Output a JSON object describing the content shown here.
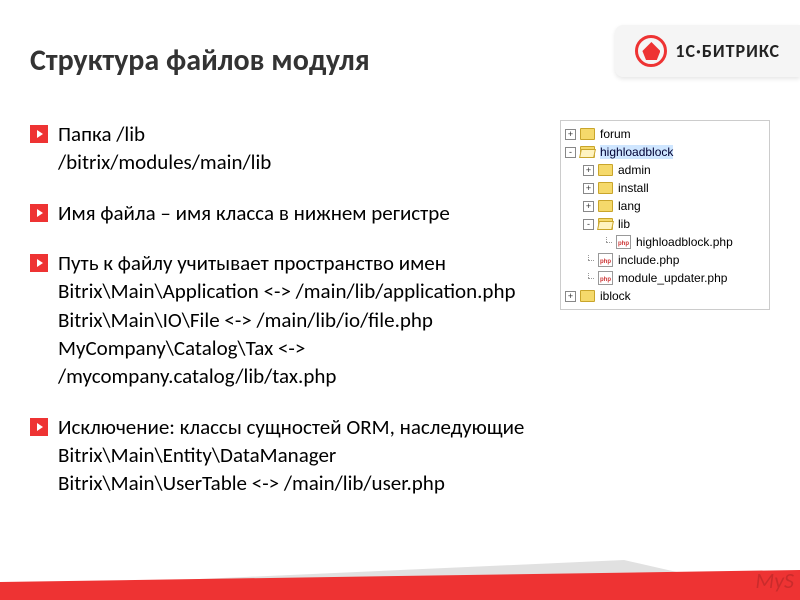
{
  "header": {
    "title": "Структура файлов модуля",
    "brand": "1С·БИТРИКС"
  },
  "bullets": [
    {
      "text": "Папка   /lib\n/bitrix/modules/main/lib"
    },
    {
      "text": "Имя файла – имя класса в нижнем регистре"
    },
    {
      "text": "Путь к файлу учитывает пространство имен\nBitrix\\Main\\Application  <->  /main/lib/application.php\nBitrix\\Main\\IO\\File  <->  /main/lib/io/file.php\nMyCompany\\Catalog\\Tax  <->  /mycompany.catalog/lib/tax.php"
    },
    {
      "text": "Исключение: классы сущностей ORM, наследующие Bitrix\\Main\\Entity\\DataManager\nBitrix\\Main\\UserTable  <->  /main/lib/user.php"
    }
  ],
  "tree": [
    {
      "level": 0,
      "toggle": "+",
      "icon": "folder",
      "label": "forum"
    },
    {
      "level": 0,
      "toggle": "-",
      "icon": "folder-open",
      "label": "highloadblock",
      "selected": true
    },
    {
      "level": 1,
      "toggle": "+",
      "icon": "folder",
      "label": "admin"
    },
    {
      "level": 1,
      "toggle": "+",
      "icon": "folder",
      "label": "install"
    },
    {
      "level": 1,
      "toggle": "+",
      "icon": "folder",
      "label": "lang"
    },
    {
      "level": 1,
      "toggle": "-",
      "icon": "folder-open",
      "label": "lib"
    },
    {
      "level": 2,
      "toggle": "",
      "icon": "php",
      "label": "highloadblock.php"
    },
    {
      "level": 1,
      "toggle": "",
      "icon": "php",
      "label": "include.php"
    },
    {
      "level": 1,
      "toggle": "",
      "icon": "php",
      "label": "module_updater.php"
    },
    {
      "level": 0,
      "toggle": "+",
      "icon": "folder",
      "label": "iblock"
    }
  ],
  "watermark": "MyS"
}
